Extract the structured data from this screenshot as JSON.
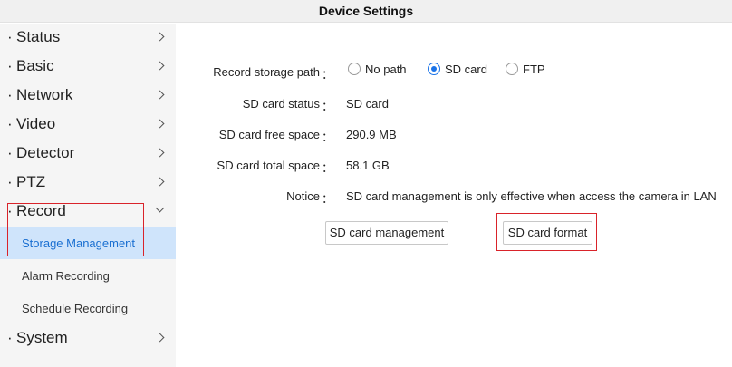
{
  "window": {
    "title": "Device Settings"
  },
  "sidebar": {
    "items": [
      {
        "label": "Status",
        "expanded": false
      },
      {
        "label": "Basic",
        "expanded": false
      },
      {
        "label": "Network",
        "expanded": false
      },
      {
        "label": "Video",
        "expanded": false
      },
      {
        "label": "Detector",
        "expanded": false
      },
      {
        "label": "PTZ",
        "expanded": false
      },
      {
        "label": "Record",
        "expanded": true
      },
      {
        "label": "System",
        "expanded": false
      }
    ],
    "record_subitems": [
      {
        "label": "Storage Management",
        "active": true
      },
      {
        "label": "Alarm Recording",
        "active": false
      },
      {
        "label": "Schedule Recording",
        "active": false
      }
    ]
  },
  "form": {
    "storage_path": {
      "label": "Record storage path",
      "options": [
        "No path",
        "SD card",
        "FTP"
      ],
      "selected": "SD card"
    },
    "sd_status": {
      "label": "SD card status",
      "value": "SD card"
    },
    "free_space": {
      "label": "SD card free space",
      "value": "290.9 MB"
    },
    "total_space": {
      "label": "SD card total space",
      "value": "58.1 GB"
    },
    "notice": {
      "label": "Notice",
      "value": "SD card management is only effective when access the camera in LAN"
    },
    "colon": "："
  },
  "buttons": {
    "management": "SD card management",
    "format": "SD card format"
  },
  "colors": {
    "highlight_box": "#d9232a",
    "active_bg": "#cfe4fb",
    "active_text": "#1a6fd1",
    "radio_checked": "#1a73e8"
  }
}
